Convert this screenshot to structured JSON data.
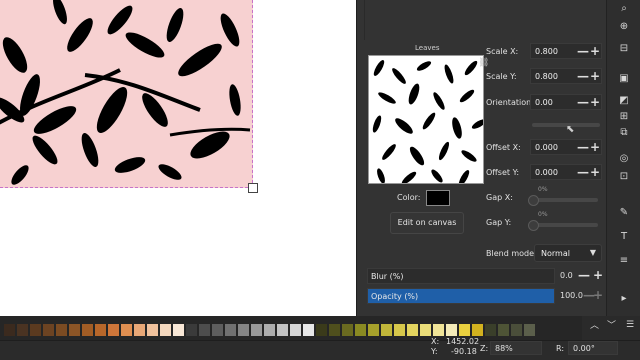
{
  "pattern": {
    "preview_title": "Leaves"
  },
  "transform": {
    "scale_x_label": "Scale X:",
    "scale_x_value": "0.800",
    "scale_y_label": "Scale Y:",
    "scale_y_value": "0.800",
    "orientation_label": "Orientation:",
    "orientation_value": "0.00",
    "offset_x_label": "Offset X:",
    "offset_x_value": "0.000",
    "offset_y_label": "Offset Y:",
    "offset_y_value": "0.000",
    "gap_x_label": "Gap X:",
    "gap_x_value": "0%",
    "gap_y_label": "Gap Y:",
    "gap_y_value": "0%",
    "spin_minus": "—",
    "spin_plus": "+"
  },
  "color": {
    "label": "Color:",
    "swatch": "#000000"
  },
  "edit_button_label": "Edit on canvas",
  "blend": {
    "label": "Blend mode:",
    "value": "Normal",
    "arrow": "▼"
  },
  "blur": {
    "label": "Blur (%)",
    "value": "0.0"
  },
  "opacity": {
    "label": "Opacity (%)",
    "value": "100.0",
    "fill_color": "#1f5fa8"
  },
  "toolbar_icons": [
    "search-icon",
    "zoom-icon",
    "xml-icon",
    "layers-icon",
    "fill-icon",
    "stroke-icon",
    "align-icon",
    "transform-icon",
    "clip-icon",
    "edit-icon",
    "text-icon",
    "objects-icon",
    "symbols-icon",
    "expand-icon"
  ],
  "palette_colors": [
    "#3b2a1e",
    "#4a3322",
    "#5b3a1f",
    "#6c4322",
    "#7b4b22",
    "#8c5526",
    "#a25d25",
    "#b8672a",
    "#d0773a",
    "#e08f51",
    "#e9a877",
    "#f0c29d",
    "#f5d9bf",
    "#f8e7d6",
    "#3a3a3a",
    "#4d4d4d",
    "#5e5e5e",
    "#717171",
    "#858585",
    "#9a9a9a",
    "#aeaeae",
    "#c3c3c3",
    "#d6d6d6",
    "#e8e8e8",
    "#3a3a1a",
    "#4f4f1d",
    "#6a6a20",
    "#8a8a22",
    "#a7a12b",
    "#c2b73a",
    "#d7c84b",
    "#e3d45f",
    "#ebdd79",
    "#f0e497",
    "#f4ebb8",
    "#e9d03f",
    "#d2b21f",
    "#3a3f2a",
    "#4e5436",
    "#4a4e3a",
    "#5b5f4b"
  ],
  "palette_controls": {
    "up": "︿",
    "down": "﹀",
    "menu": "☰"
  },
  "status": {
    "x_label": "X:",
    "x_value": "1452.02",
    "y_label": "Y:",
    "y_value": "-90.18",
    "zoom_label": "Z:",
    "zoom_value": "88%",
    "rotation_label": "R:",
    "rotation_value": "0.00°"
  }
}
